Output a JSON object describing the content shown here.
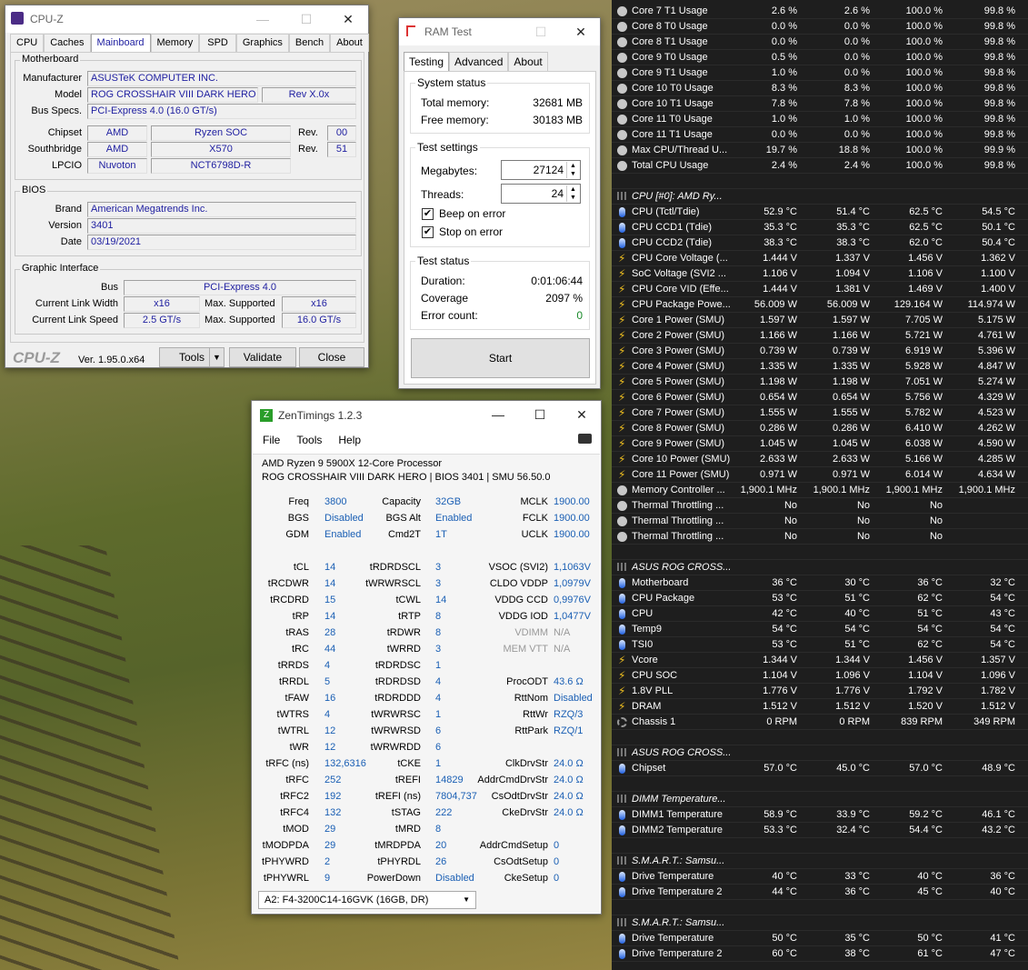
{
  "cpuz": {
    "title": "CPU-Z",
    "tabs": [
      "CPU",
      "Caches",
      "Mainboard",
      "Memory",
      "SPD",
      "Graphics",
      "Bench",
      "About"
    ],
    "motherboard": {
      "group": "Motherboard",
      "manufacturer_label": "Manufacturer",
      "manufacturer": "ASUSTeK COMPUTER INC.",
      "model_label": "Model",
      "model": "ROG CROSSHAIR VIII DARK HERO",
      "rev": "Rev X.0x",
      "busspecs_label": "Bus Specs.",
      "busspecs": "PCI-Express 4.0 (16.0 GT/s)",
      "chipset_label": "Chipset",
      "chipset_vendor": "AMD",
      "chipset_name": "Ryzen SOC",
      "chipset_rev_label": "Rev.",
      "chipset_rev": "00",
      "south_label": "Southbridge",
      "south_vendor": "AMD",
      "south_name": "X570",
      "south_rev_label": "Rev.",
      "south_rev": "51",
      "lpcio_label": "LPCIO",
      "lpcio_vendor": "Nuvoton",
      "lpcio_name": "NCT6798D-R"
    },
    "bios": {
      "group": "BIOS",
      "brand_label": "Brand",
      "brand": "American Megatrends Inc.",
      "version_label": "Version",
      "version": "3401",
      "date_label": "Date",
      "date": "03/19/2021"
    },
    "graphic": {
      "group": "Graphic Interface",
      "bus_label": "Bus",
      "bus": "PCI-Express 4.0",
      "clw_label": "Current Link Width",
      "clw": "x16",
      "maxs_label": "Max. Supported",
      "maxw": "x16",
      "cls_label": "Current Link Speed",
      "cls": "2.5 GT/s",
      "maxs2_label": "Max. Supported",
      "maxsp": "16.0 GT/s"
    },
    "footer": {
      "logo": "CPU-Z",
      "version": "Ver. 1.95.0.x64",
      "tools": "Tools",
      "validate": "Validate",
      "close": "Close"
    }
  },
  "ramtest": {
    "title": "RAM Test",
    "tabs": [
      "Testing",
      "Advanced",
      "About"
    ],
    "sys_status": "System status",
    "total_label": "Total memory:",
    "total": "32681 MB",
    "free_label": "Free memory:",
    "free": "30183 MB",
    "settings": "Test settings",
    "mb_label": "Megabytes:",
    "mb": "27124",
    "threads_label": "Threads:",
    "threads": "24",
    "beep": "Beep on error",
    "stop": "Stop on error",
    "test_status": "Test status",
    "dur_label": "Duration:",
    "dur": "0:01:06:44",
    "cov_label": "Coverage",
    "cov": "2097 %",
    "err_label": "Error count:",
    "err": "0",
    "start": "Start"
  },
  "zen": {
    "title": "ZenTimings 1.2.3",
    "menu": [
      "File",
      "Tools",
      "Help"
    ],
    "cpu": "AMD Ryzen 9 5900X 12-Core Processor",
    "board": "ROG CROSSHAIR VIII DARK HERO | BIOS 3401 | SMU 56.50.0",
    "rows": [
      [
        [
          "Freq",
          "3800"
        ],
        [
          "Capacity",
          "32GB"
        ],
        [
          "MCLK",
          "1900.00"
        ]
      ],
      [
        [
          "BGS",
          "Disabled"
        ],
        [
          "BGS Alt",
          "Enabled"
        ],
        [
          "FCLK",
          "1900.00"
        ]
      ],
      [
        [
          "GDM",
          "Enabled"
        ],
        [
          "Cmd2T",
          "1T"
        ],
        [
          "UCLK",
          "1900.00"
        ]
      ],
      [
        [
          "",
          ""
        ],
        [
          "",
          ""
        ],
        [
          "",
          ""
        ]
      ],
      [
        [
          "tCL",
          "14"
        ],
        [
          "tRDRDSCL",
          "3"
        ],
        [
          "VSOC (SVI2)",
          "1,1063V"
        ]
      ],
      [
        [
          "tRCDWR",
          "14"
        ],
        [
          "tWRWRSCL",
          "3"
        ],
        [
          "CLDO VDDP",
          "1,0979V"
        ]
      ],
      [
        [
          "tRCDRD",
          "15"
        ],
        [
          "tCWL",
          "14"
        ],
        [
          "VDDG CCD",
          "0,9976V"
        ]
      ],
      [
        [
          "tRP",
          "14"
        ],
        [
          "tRTP",
          "8"
        ],
        [
          "VDDG IOD",
          "1,0477V"
        ]
      ],
      [
        [
          "tRAS",
          "28"
        ],
        [
          "tRDWR",
          "8"
        ],
        [
          "VDIMM",
          "N/A"
        ]
      ],
      [
        [
          "tRC",
          "44"
        ],
        [
          "tWRRD",
          "3"
        ],
        [
          "MEM VTT",
          "N/A"
        ]
      ],
      [
        [
          "tRRDS",
          "4"
        ],
        [
          "tRDRDSC",
          "1"
        ],
        [
          "",
          ""
        ]
      ],
      [
        [
          "tRRDL",
          "5"
        ],
        [
          "tRDRDSD",
          "4"
        ],
        [
          "ProcODT",
          "43.6 Ω"
        ]
      ],
      [
        [
          "tFAW",
          "16"
        ],
        [
          "tRDRDDD",
          "4"
        ],
        [
          "RttNom",
          "Disabled"
        ]
      ],
      [
        [
          "tWTRS",
          "4"
        ],
        [
          "tWRWRSC",
          "1"
        ],
        [
          "RttWr",
          "RZQ/3"
        ]
      ],
      [
        [
          "tWTRL",
          "12"
        ],
        [
          "tWRWRSD",
          "6"
        ],
        [
          "RttPark",
          "RZQ/1"
        ]
      ],
      [
        [
          "tWR",
          "12"
        ],
        [
          "tWRWRDD",
          "6"
        ],
        [
          "",
          ""
        ]
      ],
      [
        [
          "tRFC (ns)",
          "132,6316"
        ],
        [
          "tCKE",
          "1"
        ],
        [
          "ClkDrvStr",
          "24.0 Ω"
        ]
      ],
      [
        [
          "tRFC",
          "252"
        ],
        [
          "tREFI",
          "14829"
        ],
        [
          "AddrCmdDrvStr",
          "24.0 Ω"
        ]
      ],
      [
        [
          "tRFC2",
          "192"
        ],
        [
          "tREFI (ns)",
          "7804,737"
        ],
        [
          "CsOdtDrvStr",
          "24.0 Ω"
        ]
      ],
      [
        [
          "tRFC4",
          "132"
        ],
        [
          "tSTAG",
          "222"
        ],
        [
          "CkeDrvStr",
          "24.0 Ω"
        ]
      ],
      [
        [
          "tMOD",
          "29"
        ],
        [
          "tMRD",
          "8"
        ],
        [
          "",
          ""
        ]
      ],
      [
        [
          "tMODPDA",
          "29"
        ],
        [
          "tMRDPDA",
          "20"
        ],
        [
          "AddrCmdSetup",
          "0"
        ]
      ],
      [
        [
          "tPHYWRD",
          "2"
        ],
        [
          "tPHYRDL",
          "26"
        ],
        [
          "CsOdtSetup",
          "0"
        ]
      ],
      [
        [
          "tPHYWRL",
          "9"
        ],
        [
          "PowerDown",
          "Disabled"
        ],
        [
          "CkeSetup",
          "0"
        ]
      ]
    ],
    "dimm": "A2: F4-3200C14-16GVK (16GB, DR)"
  },
  "hwinfo": {
    "rows": [
      {
        "i": "circ",
        "n": "Core 7 T1 Usage",
        "v": [
          "2.6 %",
          "2.6 %",
          "100.0 %",
          "99.8 %"
        ]
      },
      {
        "i": "circ",
        "n": "Core 8 T0 Usage",
        "v": [
          "0.0 %",
          "0.0 %",
          "100.0 %",
          "99.8 %"
        ]
      },
      {
        "i": "circ",
        "n": "Core 8 T1 Usage",
        "v": [
          "0.0 %",
          "0.0 %",
          "100.0 %",
          "99.8 %"
        ]
      },
      {
        "i": "circ",
        "n": "Core 9 T0 Usage",
        "v": [
          "0.5 %",
          "0.0 %",
          "100.0 %",
          "99.8 %"
        ]
      },
      {
        "i": "circ",
        "n": "Core 9 T1 Usage",
        "v": [
          "1.0 %",
          "0.0 %",
          "100.0 %",
          "99.8 %"
        ]
      },
      {
        "i": "circ",
        "n": "Core 10 T0 Usage",
        "v": [
          "8.3 %",
          "8.3 %",
          "100.0 %",
          "99.8 %"
        ]
      },
      {
        "i": "circ",
        "n": "Core 10 T1 Usage",
        "v": [
          "7.8 %",
          "7.8 %",
          "100.0 %",
          "99.8 %"
        ]
      },
      {
        "i": "circ",
        "n": "Core 11 T0 Usage",
        "v": [
          "1.0 %",
          "1.0 %",
          "100.0 %",
          "99.8 %"
        ]
      },
      {
        "i": "circ",
        "n": "Core 11 T1 Usage",
        "v": [
          "0.0 %",
          "0.0 %",
          "100.0 %",
          "99.8 %"
        ]
      },
      {
        "i": "circ",
        "n": "Max CPU/Thread U...",
        "v": [
          "19.7 %",
          "18.8 %",
          "100.0 %",
          "99.9 %"
        ]
      },
      {
        "i": "circ",
        "n": "Total CPU Usage",
        "v": [
          "2.4 %",
          "2.4 %",
          "100.0 %",
          "99.8 %"
        ]
      },
      {
        "i": "",
        "n": "",
        "v": [
          "",
          "",
          "",
          ""
        ]
      },
      {
        "i": "chip",
        "n": "CPU [#0]: AMD Ry...",
        "v": [
          "",
          "",
          "",
          ""
        ],
        "h": true
      },
      {
        "i": "therm",
        "n": "CPU (Tctl/Tdie)",
        "v": [
          "52.9 °C",
          "51.4 °C",
          "62.5 °C",
          "54.5 °C"
        ]
      },
      {
        "i": "therm",
        "n": "CPU CCD1 (Tdie)",
        "v": [
          "35.3 °C",
          "35.3 °C",
          "62.5 °C",
          "50.1 °C"
        ]
      },
      {
        "i": "therm",
        "n": "CPU CCD2 (Tdie)",
        "v": [
          "38.3 °C",
          "38.3 °C",
          "62.0 °C",
          "50.4 °C"
        ]
      },
      {
        "i": "bolt",
        "n": "CPU Core Voltage (...",
        "v": [
          "1.444 V",
          "1.337 V",
          "1.456 V",
          "1.362 V"
        ]
      },
      {
        "i": "bolt",
        "n": "SoC Voltage (SVI2 ...",
        "v": [
          "1.106 V",
          "1.094 V",
          "1.106 V",
          "1.100 V"
        ]
      },
      {
        "i": "bolt",
        "n": "CPU Core VID (Effe...",
        "v": [
          "1.444 V",
          "1.381 V",
          "1.469 V",
          "1.400 V"
        ]
      },
      {
        "i": "bolt",
        "n": "CPU Package Powe...",
        "v": [
          "56.009 W",
          "56.009 W",
          "129.164 W",
          "114.974 W"
        ]
      },
      {
        "i": "bolt",
        "n": "Core 1 Power (SMU)",
        "v": [
          "1.597 W",
          "1.597 W",
          "7.705 W",
          "5.175 W"
        ]
      },
      {
        "i": "bolt",
        "n": "Core 2 Power (SMU)",
        "v": [
          "1.166 W",
          "1.166 W",
          "5.721 W",
          "4.761 W"
        ]
      },
      {
        "i": "bolt",
        "n": "Core 3 Power (SMU)",
        "v": [
          "0.739 W",
          "0.739 W",
          "6.919 W",
          "5.396 W"
        ]
      },
      {
        "i": "bolt",
        "n": "Core 4 Power (SMU)",
        "v": [
          "1.335 W",
          "1.335 W",
          "5.928 W",
          "4.847 W"
        ]
      },
      {
        "i": "bolt",
        "n": "Core 5 Power (SMU)",
        "v": [
          "1.198 W",
          "1.198 W",
          "7.051 W",
          "5.274 W"
        ]
      },
      {
        "i": "bolt",
        "n": "Core 6 Power (SMU)",
        "v": [
          "0.654 W",
          "0.654 W",
          "5.756 W",
          "4.329 W"
        ]
      },
      {
        "i": "bolt",
        "n": "Core 7 Power (SMU)",
        "v": [
          "1.555 W",
          "1.555 W",
          "5.782 W",
          "4.523 W"
        ]
      },
      {
        "i": "bolt",
        "n": "Core 8 Power (SMU)",
        "v": [
          "0.286 W",
          "0.286 W",
          "6.410 W",
          "4.262 W"
        ]
      },
      {
        "i": "bolt",
        "n": "Core 9 Power (SMU)",
        "v": [
          "1.045 W",
          "1.045 W",
          "6.038 W",
          "4.590 W"
        ]
      },
      {
        "i": "bolt",
        "n": "Core 10 Power (SMU)",
        "v": [
          "2.633 W",
          "2.633 W",
          "5.166 W",
          "4.285 W"
        ]
      },
      {
        "i": "bolt",
        "n": "Core 11 Power (SMU)",
        "v": [
          "0.971 W",
          "0.971 W",
          "6.014 W",
          "4.634 W"
        ]
      },
      {
        "i": "circ",
        "n": "Memory Controller ...",
        "v": [
          "1,900.1 MHz",
          "1,900.1 MHz",
          "1,900.1 MHz",
          "1,900.1 MHz"
        ]
      },
      {
        "i": "circ",
        "n": "Thermal Throttling ...",
        "v": [
          "No",
          "No",
          "No",
          ""
        ]
      },
      {
        "i": "circ",
        "n": "Thermal Throttling ...",
        "v": [
          "No",
          "No",
          "No",
          ""
        ]
      },
      {
        "i": "circ",
        "n": "Thermal Throttling ...",
        "v": [
          "No",
          "No",
          "No",
          ""
        ]
      },
      {
        "i": "",
        "n": "",
        "v": [
          "",
          "",
          "",
          ""
        ]
      },
      {
        "i": "chip",
        "n": "ASUS ROG CROSS...",
        "v": [
          "",
          "",
          "",
          ""
        ],
        "h": true
      },
      {
        "i": "therm",
        "n": "Motherboard",
        "v": [
          "36 °C",
          "30 °C",
          "36 °C",
          "32 °C"
        ]
      },
      {
        "i": "therm",
        "n": "CPU Package",
        "v": [
          "53 °C",
          "51 °C",
          "62 °C",
          "54 °C"
        ]
      },
      {
        "i": "therm",
        "n": "CPU",
        "v": [
          "42 °C",
          "40 °C",
          "51 °C",
          "43 °C"
        ]
      },
      {
        "i": "therm",
        "n": "Temp9",
        "v": [
          "54 °C",
          "54 °C",
          "54 °C",
          "54 °C"
        ]
      },
      {
        "i": "therm",
        "n": "TSI0",
        "v": [
          "53 °C",
          "51 °C",
          "62 °C",
          "54 °C"
        ]
      },
      {
        "i": "bolt",
        "n": "Vcore",
        "v": [
          "1.344 V",
          "1.344 V",
          "1.456 V",
          "1.357 V"
        ]
      },
      {
        "i": "bolt",
        "n": "CPU SOC",
        "v": [
          "1.104 V",
          "1.096 V",
          "1.104 V",
          "1.096 V"
        ]
      },
      {
        "i": "bolt",
        "n": "1.8V PLL",
        "v": [
          "1.776 V",
          "1.776 V",
          "1.792 V",
          "1.782 V"
        ]
      },
      {
        "i": "bolt",
        "n": "DRAM",
        "v": [
          "1.512 V",
          "1.512 V",
          "1.520 V",
          "1.512 V"
        ]
      },
      {
        "i": "fan",
        "n": "Chassis 1",
        "v": [
          "0 RPM",
          "0 RPM",
          "839 RPM",
          "349 RPM"
        ]
      },
      {
        "i": "",
        "n": "",
        "v": [
          "",
          "",
          "",
          ""
        ]
      },
      {
        "i": "chip",
        "n": "ASUS ROG CROSS...",
        "v": [
          "",
          "",
          "",
          ""
        ],
        "h": true
      },
      {
        "i": "therm",
        "n": "Chipset",
        "v": [
          "57.0 °C",
          "45.0 °C",
          "57.0 °C",
          "48.9 °C"
        ]
      },
      {
        "i": "",
        "n": "",
        "v": [
          "",
          "",
          "",
          ""
        ]
      },
      {
        "i": "chip",
        "n": "DIMM Temperature...",
        "v": [
          "",
          "",
          "",
          ""
        ],
        "h": true
      },
      {
        "i": "therm",
        "n": "DIMM1 Temperature",
        "v": [
          "58.9 °C",
          "33.9 °C",
          "59.2 °C",
          "46.1 °C"
        ]
      },
      {
        "i": "therm",
        "n": "DIMM2 Temperature",
        "v": [
          "53.3 °C",
          "32.4 °C",
          "54.4 °C",
          "43.2 °C"
        ]
      },
      {
        "i": "",
        "n": "",
        "v": [
          "",
          "",
          "",
          ""
        ]
      },
      {
        "i": "chip",
        "n": "S.M.A.R.T.: Samsu...",
        "v": [
          "",
          "",
          "",
          ""
        ],
        "h": true
      },
      {
        "i": "therm",
        "n": "Drive Temperature",
        "v": [
          "40 °C",
          "33 °C",
          "40 °C",
          "36 °C"
        ]
      },
      {
        "i": "therm",
        "n": "Drive Temperature 2",
        "v": [
          "44 °C",
          "36 °C",
          "45 °C",
          "40 °C"
        ]
      },
      {
        "i": "",
        "n": "",
        "v": [
          "",
          "",
          "",
          ""
        ]
      },
      {
        "i": "chip",
        "n": "S.M.A.R.T.: Samsu...",
        "v": [
          "",
          "",
          "",
          ""
        ],
        "h": true
      },
      {
        "i": "therm",
        "n": "Drive Temperature",
        "v": [
          "50 °C",
          "35 °C",
          "50 °C",
          "41 °C"
        ]
      },
      {
        "i": "therm",
        "n": "Drive Temperature 2",
        "v": [
          "60 °C",
          "38 °C",
          "61 °C",
          "47 °C"
        ]
      }
    ]
  }
}
